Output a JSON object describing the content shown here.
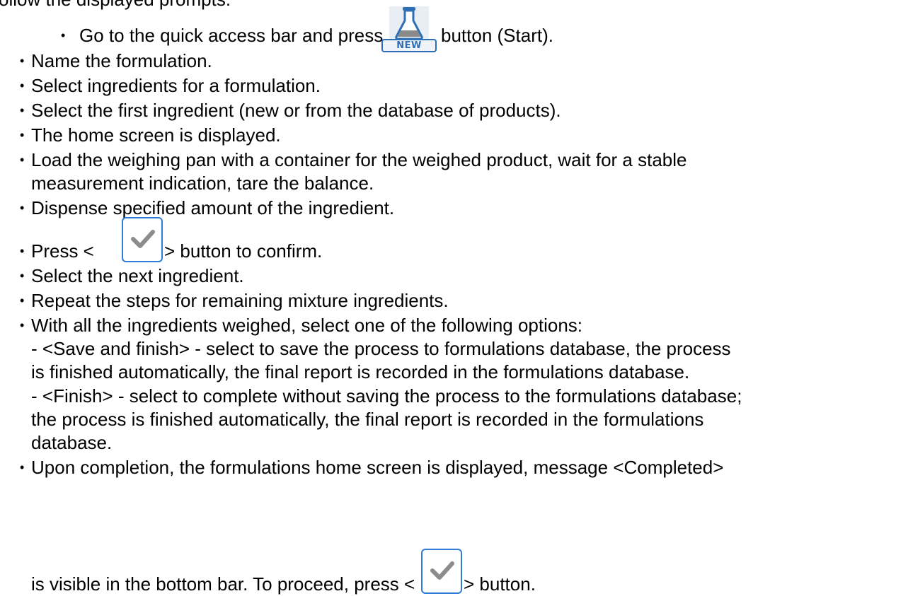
{
  "intro_fragment": "ollow the displayed prompts.",
  "icons": {
    "new_button": "flask-new-icon",
    "confirm_button": "checkmark-icon",
    "bullet": "•"
  },
  "new_button_label": "NEW",
  "steps": {
    "s1_before": "Go to the quick access bar and press",
    "s1_after": "button (Start).",
    "s2": "Name the formulation.",
    "s3": "Select ingredients for a formulation.",
    "s4": "Select the first ingredient (new or from the database of products).",
    "s5": "The home screen is displayed.",
    "s6_line1": "Load the weighing pan with a container for the weighed product, wait for a stable",
    "s6_line2": "measurement indication, tare the balance.",
    "s7": "Dispense specified amount of the ingredient.",
    "s8_before": "Press <",
    "s8_after": "> button to confirm.",
    "s9": "Select the next ingredient.",
    "s10": "Repeat the steps for remaining mixture ingredients.",
    "s11_line1": "With all the ingredients weighed, select one of the following options:",
    "s11_line2": "- <Save and finish> - select to save the process to formulations database, the process",
    "s11_line3": "is finished automatically, the final report is recorded in the formulations database.",
    "s11_line4": "- <Finish> - select to complete without saving the process to the formulations database;",
    "s11_line5": "the process is finished automatically, the final report is recorded in the formulations",
    "s11_line6": "database.",
    "s12_line1": "Upon completion,  the formulations home screen is displayed, message <Completed>",
    "s12_line2_before": "is visible in the bottom bar. To proceed, press <",
    "s12_line2_after": "> button."
  }
}
